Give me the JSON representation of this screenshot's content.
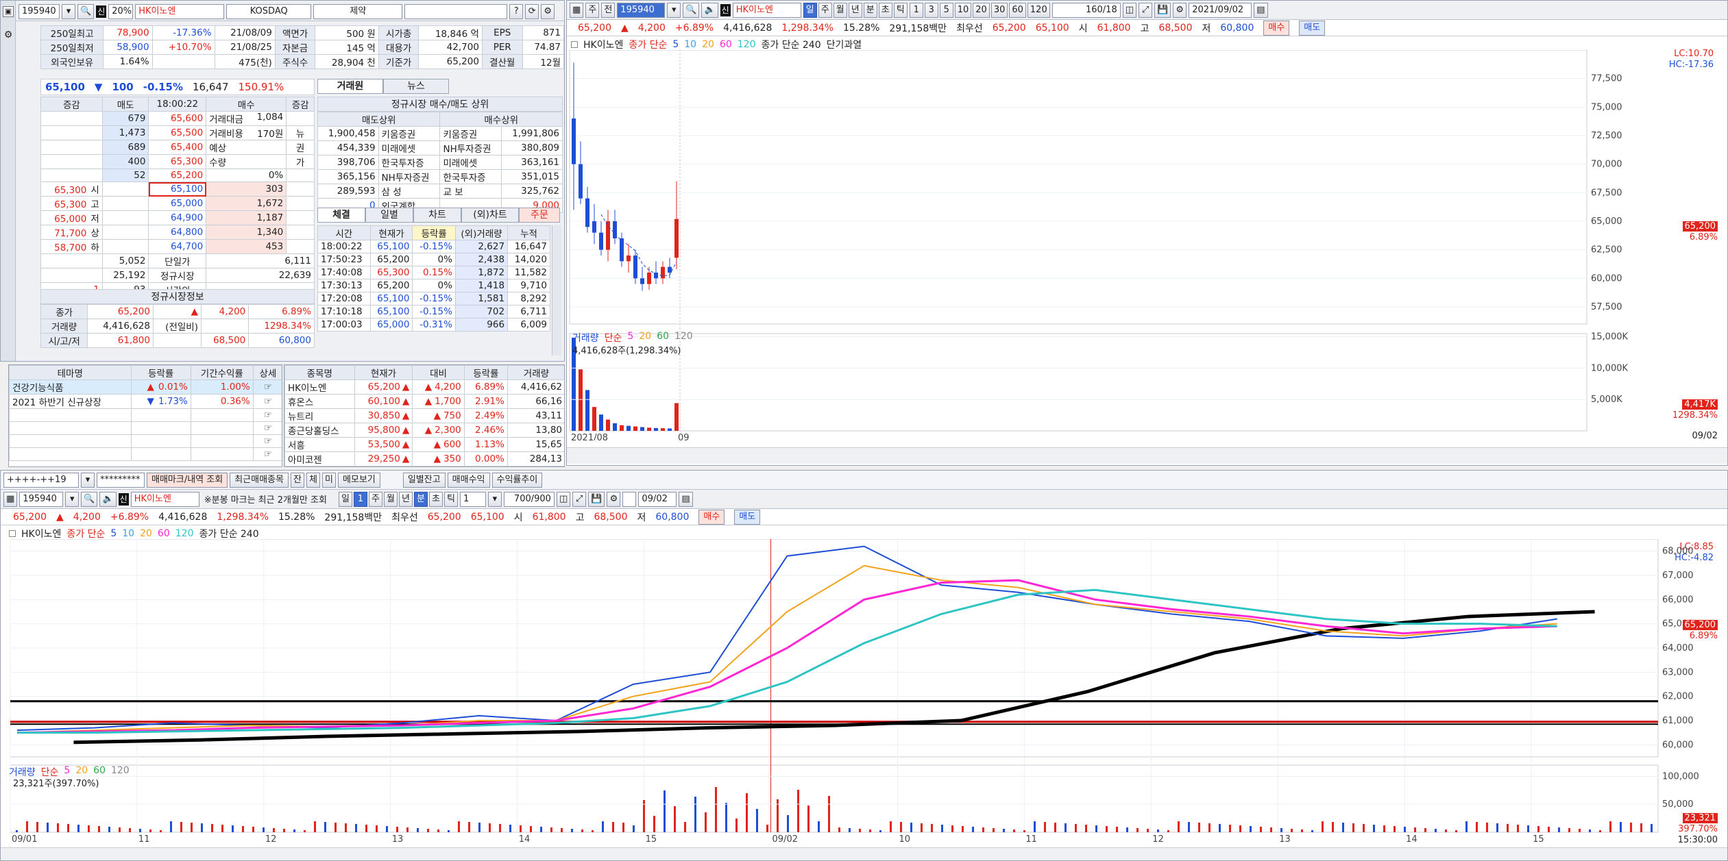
{
  "quote": {
    "code": "195940",
    "pct_box": "20%",
    "name": "HK이노엔",
    "market": "KOSDAQ",
    "sector": "제약",
    "stats": [
      [
        "250일최고",
        "78,900",
        "-17.36%",
        "21/08/09",
        "액면가",
        "500 원",
        "시가총",
        "18,846 억",
        "EPS",
        "871"
      ],
      [
        "250일최저",
        "58,900",
        "+10.70%",
        "21/08/25",
        "자본금",
        "145 억",
        "대용가",
        "42,700",
        "PER",
        "74.87"
      ],
      [
        "외국인보유",
        "1.64%",
        "",
        "475(천)",
        "주식수",
        "28,904 천",
        "기준가",
        "65,200",
        "결산월",
        "12월"
      ]
    ],
    "price_line": {
      "price": "65,100",
      "arrow": "▼",
      "change": "100",
      "pct": "-0.15%",
      "volume": "16,647",
      "ratio": "150.91%"
    },
    "tabs": [
      "거래원",
      "뉴스"
    ],
    "orderbook": {
      "head": [
        "증감",
        "매도",
        "18:00:22",
        "매수",
        "증감"
      ],
      "asks": [
        [
          "679",
          "65,600"
        ],
        [
          "1,473",
          "65,500"
        ],
        [
          "689",
          "65,400"
        ],
        [
          "400",
          "65,300"
        ],
        [
          "52",
          "65,200"
        ]
      ],
      "bids": [
        [
          "65,100",
          "303"
        ],
        [
          "65,000",
          "1,672"
        ],
        [
          "64,900",
          "1,187"
        ],
        [
          "64,800",
          "1,340"
        ],
        [
          "64,700",
          "453"
        ]
      ],
      "ask_info": [
        [
          "거래대금",
          "1,084"
        ],
        [
          "거래비용",
          "170원"
        ],
        [
          "예상",
          ""
        ],
        [
          "수량",
          ""
        ],
        [
          "",
          "0%"
        ]
      ],
      "side_chars": [
        "뉴",
        "권",
        "가"
      ],
      "bid_left": [
        [
          "65,300",
          "시"
        ],
        [
          "65,300",
          "고"
        ],
        [
          "65,000",
          "저"
        ],
        [
          "71,700",
          "상"
        ],
        [
          "58,700",
          "하"
        ]
      ],
      "totals": [
        [
          "5,052",
          "단일가",
          "6,111"
        ],
        [
          "25,192",
          "정규시장",
          "22,639"
        ],
        [
          "1",
          "93",
          "시간외",
          ""
        ]
      ]
    },
    "session": {
      "title": "정규시장정보",
      "rows": [
        [
          "종가",
          "65,200",
          "▲",
          "4,200",
          "6.89%"
        ],
        [
          "거래량",
          "4,416,628",
          "(전일비)",
          "",
          "1298.34%"
        ],
        [
          "시/고/저",
          "61,800",
          "",
          "68,500",
          "60,800"
        ]
      ]
    },
    "broker": {
      "title": "정규시장 매수/매도 상위",
      "sell_head": "매도상위",
      "buy_head": "매수상위",
      "rows": [
        [
          "1,900,458",
          "키움증권",
          "키움증권",
          "1,991,806"
        ],
        [
          "454,339",
          "미래에셋",
          "NH투자증권",
          "380,809"
        ],
        [
          "398,706",
          "한국투자증",
          "미래에셋",
          "363,161"
        ],
        [
          "365,156",
          "NH투자증권",
          "한국투자증",
          "351,015"
        ],
        [
          "289,593",
          "삼 성",
          "교 보",
          "325,762"
        ],
        [
          "0",
          "외국계합",
          "",
          "9,000"
        ]
      ]
    },
    "tick_tabs": [
      "체결",
      "일별",
      "차트",
      "(외)차트",
      "주문"
    ],
    "ticks": {
      "head": [
        "시간",
        "현재가",
        "등락률",
        "(외)거래량",
        "누적"
      ],
      "rows": [
        [
          "18:00:22",
          "65,100",
          "-0.15%",
          "2,627",
          "16,647"
        ],
        [
          "17:50:23",
          "65,200",
          "0%",
          "2,438",
          "14,020"
        ],
        [
          "17:40:08",
          "65,300",
          "0.15%",
          "1,872",
          "11,582"
        ],
        [
          "17:30:13",
          "65,200",
          "0%",
          "1,418",
          "9,710"
        ],
        [
          "17:20:08",
          "65,100",
          "-0.15%",
          "1,581",
          "8,292"
        ],
        [
          "17:10:18",
          "65,100",
          "-0.15%",
          "702",
          "6,711"
        ],
        [
          "17:00:03",
          "65,000",
          "-0.31%",
          "966",
          "6,009"
        ]
      ]
    },
    "theme": {
      "head": [
        "테마명",
        "등락률",
        "기간수익률",
        "상세"
      ],
      "rows": [
        [
          "건강기능식품",
          "▲",
          "0.01%",
          "1.00%"
        ],
        [
          "2021 하반기 신규상장",
          "▼",
          "1.73%",
          "0.36%"
        ],
        [
          "",
          "",
          "",
          ""
        ],
        [
          "",
          "",
          "",
          ""
        ],
        [
          "",
          "",
          "",
          ""
        ],
        [
          "",
          "",
          "",
          ""
        ]
      ]
    },
    "stocks": {
      "head": [
        "종목명",
        "현재가",
        "대비",
        "등락률",
        "거래량"
      ],
      "rows": [
        [
          "HK이노엔",
          "65,200",
          "4,200",
          "6.89%",
          "4,416,62"
        ],
        [
          "휴온스",
          "60,100",
          "1,700",
          "2.91%",
          "66,16"
        ],
        [
          "뉴트리",
          "30,850",
          "750",
          "2.49%",
          "43,11"
        ],
        [
          "종근당홀딩스",
          "95,800",
          "2,300",
          "2.46%",
          "13,80"
        ],
        [
          "서흥",
          "53,500",
          "600",
          "1.13%",
          "15,65"
        ],
        [
          "아미코젠",
          "29,250",
          "350",
          "0.00%",
          "284,13"
        ]
      ]
    },
    "daily": {
      "toolbar": {
        "period": "주",
        "range": "전",
        "code": "195940",
        "name": "HK이노엔",
        "buttons": [
          "일",
          "주",
          "월",
          "년",
          "분",
          "초",
          "틱"
        ],
        "nums": [
          "1",
          "3",
          "5",
          "10",
          "20",
          "30",
          "60",
          "120"
        ],
        "count": "160/18",
        "date": "2021/09/02"
      },
      "info": {
        "close": "65,200",
        "arrow": "▲",
        "chg": "4,200",
        "pct": "+6.89%",
        "vol": "4,416,628",
        "vol_pct": "1,298.34%",
        "turn": "15.28%",
        "amount": "291,158백만",
        "best": "최우선",
        "ask": "65,200",
        "bid": "65,100",
        "open_l": "시",
        "open": "61,800",
        "high_l": "고",
        "high": "68,500",
        "low_l": "저",
        "low": "60,800",
        "buy": "매수",
        "sell": "매도"
      },
      "legend": {
        "name": "HK이노엔",
        "ma": "종가 단순",
        "ma_periods": [
          "5",
          "10",
          "20",
          "60",
          "120"
        ],
        "ma240": "종가 단순 240",
        "extra": "단기과열"
      },
      "lc": "LC:10.70",
      "hc": "HC:-17.36",
      "price_ticks": [
        "77,500",
        "75,000",
        "72,500",
        "70,000",
        "67,500",
        "65,000",
        "62,500",
        "60,000",
        "57,500"
      ],
      "last_tag": "65,200",
      "last_pct": "6.89%",
      "vol_legend": {
        "name": "거래량",
        "ma": "단순",
        "periods": [
          "5",
          "20",
          "60",
          "120"
        ],
        "last": "4,416,628주(1,298.34%)"
      },
      "vol_ticks": [
        "15,000K",
        "10,000K",
        "5,000K"
      ],
      "vol_tag": "4,417K",
      "vol_pct_tag": "1298.34%",
      "x_labels": [
        "2021/08",
        "09"
      ],
      "end_date": "09/02"
    },
    "intraday": {
      "bar1": {
        "a": "++++-++19",
        "b": "*********",
        "c": "매매마크/내역 조회",
        "d": "최근매매종목",
        "e": [
          "잔",
          "체",
          "미"
        ],
        "f": "메모보기",
        "g": "일별잔고",
        "h": "매매수익",
        "i": "수익률추이"
      },
      "toolbar": {
        "code": "195940",
        "name": "HK이노엔",
        "note": "※분봉 마크는 최근 2개월만 조회",
        "buttons": [
          "일",
          "1",
          "주",
          "월",
          "년",
          "분",
          "초",
          "틱"
        ],
        "tick_n": "1",
        "count": "700/900",
        "date": "09/02"
      },
      "info": {
        "close": "65,200",
        "arrow": "▲",
        "chg": "4,200",
        "pct": "+6.89%",
        "vol": "4,416,628",
        "vol_pct": "1,298.34%",
        "turn": "15.28%",
        "amount": "291,158백만",
        "best": "최우선",
        "ask": "65,200",
        "bid": "65,100",
        "open_l": "시",
        "open": "61,800",
        "high_l": "고",
        "high": "68,500",
        "low_l": "저",
        "low": "60,800",
        "buy": "매수",
        "sell": "매도"
      },
      "legend": {
        "name": "HK이노엔",
        "ma": "종가 단순",
        "ma_periods": [
          "5",
          "10",
          "20",
          "60",
          "120"
        ],
        "ma240": "종가 단순 240"
      },
      "lc": "LC:8.85",
      "hc": "HC:-4.82",
      "price_ticks": [
        "68,000",
        "67,000",
        "66,000",
        "65,000",
        "64,000",
        "63,000",
        "62,000",
        "61,000",
        "60,000"
      ],
      "last_tag": "65,200",
      "last_pct": "6.89%",
      "vol_legend": {
        "name": "거래량",
        "ma": "단순",
        "periods": [
          "5",
          "20",
          "60",
          "120"
        ],
        "last": "23,321주(397.70%)"
      },
      "vol_ticks": [
        "100,000",
        "50,000"
      ],
      "vol_tag": "23,321",
      "vol_pct_tag": "397.70%",
      "x_labels": [
        "09/01",
        "11",
        "12",
        "13",
        "14",
        "15",
        "09/02",
        "10",
        "11",
        "12",
        "13",
        "14",
        "15"
      ],
      "end_time": "15:30:00"
    },
    "colors": {
      "up": "#e0241c",
      "down": "#1f4ed6",
      "ma5": "#1f4ed6",
      "ma10": "#3aa0e8",
      "ma20": "#f2a21b",
      "ma60": "#ff26d4",
      "ma120": "#2fc4c4",
      "ma240": "#000000",
      "accent": "#3e6fd0"
    }
  },
  "chart_data": [
    {
      "type": "candlestick",
      "title": "",
      "series": [
        {
          "name": "HK이노엔",
          "values": [
            [
              74,
              78.9,
              66,
              70
            ],
            [
              70,
              72,
              66.5,
              67
            ],
            [
              67,
              68,
              64,
              64.5
            ],
            [
              65,
              66.5,
              63,
              64
            ],
            [
              64,
              65,
              62,
              62.5
            ],
            [
              62.5,
              66,
              61.5,
              65
            ],
            [
              65,
              66,
              63,
              63.5
            ],
            [
              63.5,
              64,
              61,
              61.5
            ],
            [
              61.5,
              63,
              60.5,
              62
            ],
            [
              62,
              62.5,
              59.5,
              60
            ],
            [
              60,
              61,
              58.9,
              59.5
            ],
            [
              59.5,
              61,
              59,
              60.5
            ],
            [
              60.5,
              61.5,
              59.5,
              60
            ],
            [
              60,
              61.5,
              59.5,
              61
            ],
            [
              61,
              61.8,
              60,
              60.5
            ],
            [
              61.8,
              68.5,
              60.8,
              65.2
            ]
          ]
        }
      ],
      "ylim": [
        56000,
        80000
      ]
    },
    {
      "type": "bar",
      "title": "",
      "series": [
        {
          "name": "거래량",
          "values": [
            15200,
            9800,
            6500,
            3800,
            2600,
            1800,
            1200,
            900,
            800,
            700,
            600,
            500,
            450,
            420,
            380,
            4416628
          ]
        }
      ]
    },
    {
      "type": "line",
      "title": "",
      "x": [
        "09/01",
        "11",
        "12",
        "13",
        "14",
        "15",
        "09/02",
        "10",
        "11",
        "12",
        "13",
        "14",
        "15"
      ],
      "ylim": [
        59500,
        68500
      ],
      "series": [
        {
          "name": "240",
          "values": [
            60.1,
            60.2,
            60.35,
            60.45,
            60.55,
            60.7,
            60.8,
            61.0,
            62.2,
            63.8,
            64.8,
            65.3,
            65.5
          ]
        }
      ]
    }
  ]
}
